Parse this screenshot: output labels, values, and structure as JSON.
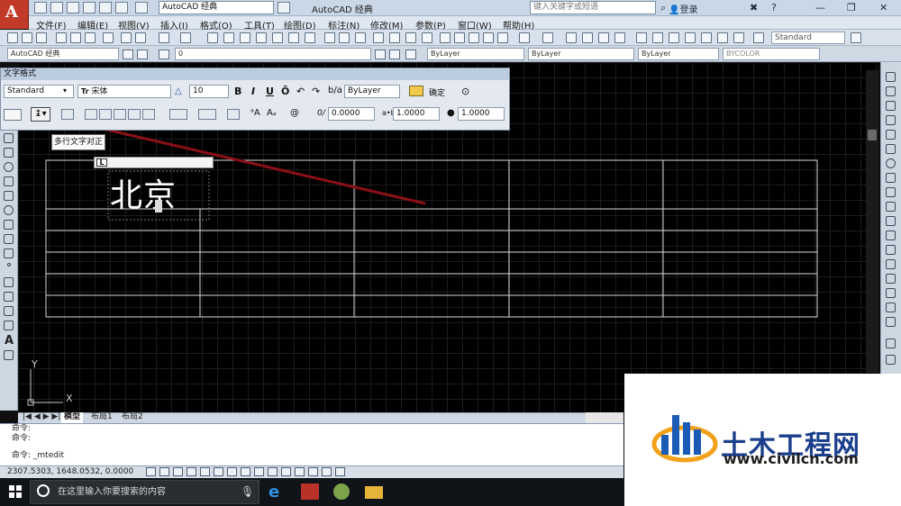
{
  "titlebar": {
    "workspace": "AutoCAD 经典",
    "title": "AutoCAD 经典",
    "search_placeholder": "键入关键字或短语",
    "login": "登录"
  },
  "menu": [
    "文件(F)",
    "编辑(E)",
    "视图(V)",
    "插入(I)",
    "格式(O)",
    "工具(T)",
    "绘图(D)",
    "标注(N)",
    "修改(M)",
    "参数(P)",
    "窗口(W)",
    "帮助(H)"
  ],
  "toolbar1": {
    "style_dropdown": "Standard"
  },
  "toolbar2": {
    "workspace": "AutoCAD 经典",
    "layer": "0",
    "color": "ByLayer",
    "linetype": "ByLayer",
    "lineweight": "ByLayer",
    "plotstyle": "BYCOLOR"
  },
  "text_format": {
    "header": "文字格式",
    "style": "Standard",
    "font": "宋体",
    "font_prefix": "Tr",
    "height": "10",
    "bold": "B",
    "italic": "I",
    "underline": "U",
    "overline": "Ō",
    "color": "ByLayer",
    "ok": "确定",
    "oblique_value": "0.0000",
    "tracking_value": "1.0000",
    "width_value": "1.0000",
    "oblique_label": "0/",
    "tracking_label": "a•b",
    "at_symbol": "@"
  },
  "tooltip": "多行文字对正",
  "mtext": {
    "content": "北京",
    "ruler_tab": "L"
  },
  "ucs": {
    "x": "X",
    "y": "Y"
  },
  "layout_tabs": [
    "模型",
    "布局1",
    "布局2"
  ],
  "command": {
    "lines": [
      "命令:",
      "命令:"
    ],
    "current": "命令:  _mtedit"
  },
  "status": {
    "coords": "2307.5303,  1648.0532,  0.0000"
  },
  "taskbar": {
    "search": "在这里输入你要搜索的内容"
  },
  "watermark": {
    "name": "土木工程网",
    "url": "www.civilcn.com"
  }
}
